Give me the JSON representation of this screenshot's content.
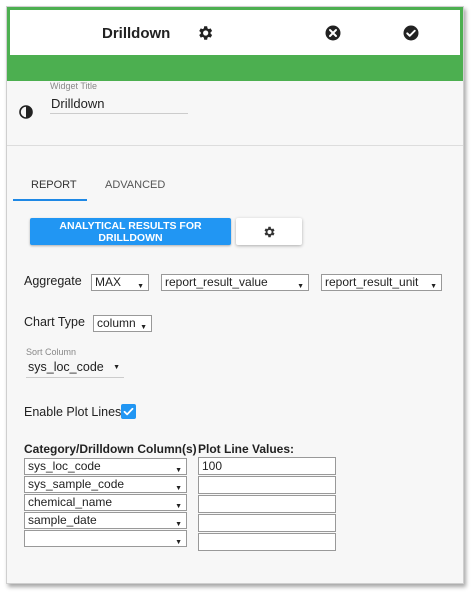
{
  "header": {
    "title": "Drilldown",
    "icons": [
      "gear-icon",
      "close-circle-icon",
      "check-circle-icon"
    ],
    "accent_color": "#4caf50"
  },
  "widget_title": {
    "label": "Widget Title",
    "value": "Drilldown"
  },
  "tabs": [
    {
      "label": "REPORT",
      "active": true
    },
    {
      "label": "ADVANCED",
      "active": false
    }
  ],
  "buttons": {
    "analytical_results": "ANALYTICAL RESULTS FOR DRILLDOWN",
    "settings_icon": "gear-icon",
    "primary_color": "#2196f3"
  },
  "aggregate": {
    "label": "Aggregate",
    "function": "MAX",
    "value_field": "report_result_value",
    "unit_field": "report_result_unit"
  },
  "chart_type": {
    "label": "Chart Type",
    "value": "column"
  },
  "sort_column": {
    "label": "Sort Column",
    "value": "sys_loc_code"
  },
  "plot_lines": {
    "label": "Enable Plot Lines",
    "checked": true
  },
  "drilldown_table": {
    "category_header": "Category/Drilldown Column(s)",
    "plot_line_header": "Plot Line Values:",
    "categories": [
      "sys_loc_code",
      "sys_sample_code",
      "chemical_name",
      "sample_date",
      ""
    ],
    "plot_values": [
      "100",
      "",
      "",
      "",
      ""
    ]
  }
}
